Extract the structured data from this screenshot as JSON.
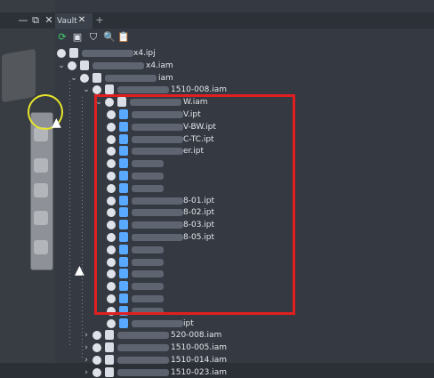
{
  "tab": {
    "title": "Vault",
    "close": "✕",
    "add": "+"
  },
  "window": {
    "minimize": "—",
    "restore": "⧉",
    "close": "✕"
  },
  "toolbar": {
    "refresh": "⟳",
    "filter": "⛉",
    "search": "🔍",
    "clipboard": "📋"
  },
  "tree": [
    {
      "type": "file",
      "label": "...x4.ipj",
      "indent": 0
    },
    {
      "type": "asm",
      "label": "...x4.iam",
      "indent": 0
    },
    {
      "type": "asm",
      "label": "...iam",
      "indent": 1
    },
    {
      "type": "asm",
      "label": "...1510-008.iam",
      "indent": 2
    },
    {
      "type": "asm",
      "label": "...W.iam",
      "indent": 3
    },
    {
      "type": "part",
      "label": "...V.ipt",
      "indent": 4
    },
    {
      "type": "part",
      "label": "...V-BW.ipt",
      "indent": 4
    },
    {
      "type": "part",
      "label": "...C-TC.ipt",
      "indent": 4
    },
    {
      "type": "part",
      "label": "...er.ipt",
      "indent": 4
    },
    {
      "type": "part",
      "label": "",
      "indent": 4
    },
    {
      "type": "part",
      "label": "",
      "indent": 4
    },
    {
      "type": "part",
      "label": "",
      "indent": 4
    },
    {
      "type": "part",
      "label": "...8-01.ipt",
      "indent": 4
    },
    {
      "type": "part",
      "label": "...8-02.ipt",
      "indent": 4
    },
    {
      "type": "part",
      "label": "...8-03.ipt",
      "indent": 4
    },
    {
      "type": "part",
      "label": "...8-05.ipt",
      "indent": 4
    },
    {
      "type": "part",
      "label": "",
      "indent": 4
    },
    {
      "type": "part",
      "label": "",
      "indent": 4
    },
    {
      "type": "part",
      "label": "",
      "indent": 4
    },
    {
      "type": "part",
      "label": "",
      "indent": 4
    },
    {
      "type": "part",
      "label": "",
      "indent": 4
    },
    {
      "type": "part",
      "label": "",
      "indent": 4
    },
    {
      "type": "part",
      "label": "...ipt",
      "indent": 4
    },
    {
      "type": "asm",
      "label": "...520-008.iam",
      "indent": 2
    },
    {
      "type": "asm",
      "label": "...1510-005.iam",
      "indent": 2
    },
    {
      "type": "asm",
      "label": "...1510-014.iam",
      "indent": 2
    },
    {
      "type": "asm",
      "label": "...1510-023.iam",
      "indent": 2
    }
  ]
}
